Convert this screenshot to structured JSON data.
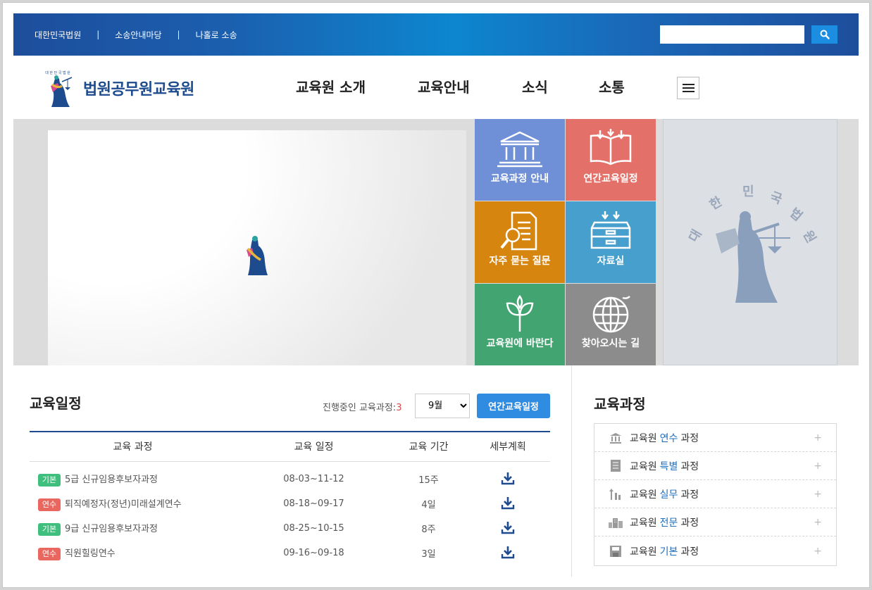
{
  "top_links": [
    "대한민국법원",
    "소송안내마당",
    "나홀로 소송"
  ],
  "top_separator": "|",
  "search": {
    "placeholder": ""
  },
  "logo": {
    "text": "법원공무원교육원",
    "seal_text": "대한민국법원"
  },
  "nav": [
    "교육원 소개",
    "교육안내",
    "소식",
    "소통"
  ],
  "tiles": [
    {
      "label": "교육과정 안내",
      "color": "#6f8fd7",
      "icon": "building-icon"
    },
    {
      "label": "연간교육일정",
      "color": "#e37169",
      "icon": "book-icon"
    },
    {
      "label": "자주 묻는 질문",
      "color": "#d6850f",
      "icon": "document-search-icon"
    },
    {
      "label": "자료실",
      "color": "#469fcc",
      "icon": "archive-box-icon"
    },
    {
      "label": "교육원에 바란다",
      "color": "#42a471",
      "icon": "sprout-icon"
    },
    {
      "label": "찾아오시는 길",
      "color": "#8c8c8c",
      "icon": "globe-icon"
    }
  ],
  "emblem": {
    "text": "대한민국법원"
  },
  "schedule": {
    "title": "교육일정",
    "progress_label": "진행중인 교육과정:",
    "progress_count": "3",
    "month": "9월",
    "month_options": [
      "9월"
    ],
    "annual_button": "연간교육일정",
    "headers": [
      "교육 과정",
      "교육 일정",
      "교육 기간",
      "세부계획"
    ],
    "rows": [
      {
        "badge": "기본",
        "type": "basic",
        "name": "5급 신규임용후보자과정",
        "dates": "08-03~11-12",
        "period": "15주"
      },
      {
        "badge": "연수",
        "type": "cont",
        "name": "퇴직예정자(정년)미래설계연수",
        "dates": "08-18~09-17",
        "period": "4일"
      },
      {
        "badge": "기본",
        "type": "basic",
        "name": "9급 신규임용후보자과정",
        "dates": "08-25~10-15",
        "period": "8주"
      },
      {
        "badge": "연수",
        "type": "cont",
        "name": "직원힐링연수",
        "dates": "09-16~09-18",
        "period": "3일"
      }
    ]
  },
  "courses": {
    "title": "교육과정",
    "prefix": "교육원",
    "items": [
      {
        "highlight": "연수",
        "suffix": "과정",
        "icon": "pillar-icon"
      },
      {
        "highlight": "특별",
        "suffix": "과정",
        "icon": "document-icon"
      },
      {
        "highlight": "실무",
        "suffix": "과정",
        "icon": "chart-icon"
      },
      {
        "highlight": "전문",
        "suffix": "과정",
        "icon": "buildings-icon"
      },
      {
        "highlight": "기본",
        "suffix": "과정",
        "icon": "save-icon"
      }
    ],
    "expand": "+"
  },
  "colors": {
    "accent": "#1e4b8e",
    "button": "#2f8ce0",
    "link": "#1e6fc0"
  }
}
